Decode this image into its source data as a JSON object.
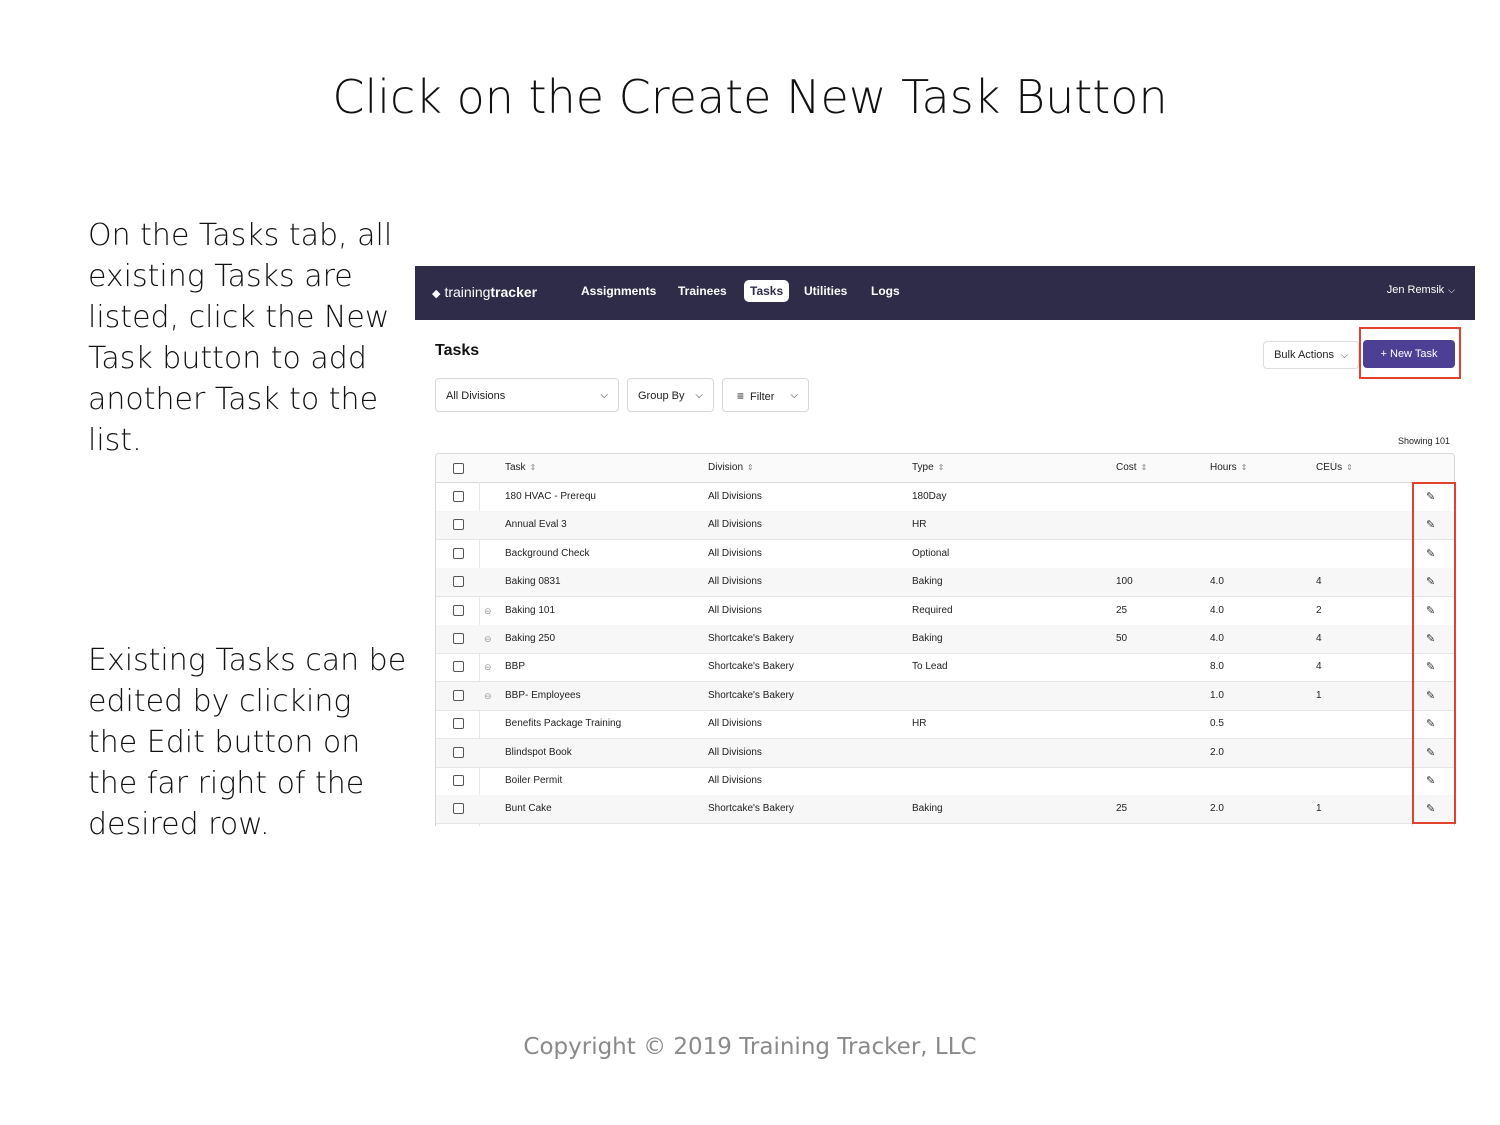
{
  "slide": {
    "title": "Click on the Create New Task Button",
    "instruction_1": "On the Tasks tab, all existing Tasks are listed, click the New Task button to add another Task to the list.",
    "instruction_2": "Existing Tasks can be edited by clicking the Edit button on the far right of the desired row.",
    "copyright": "Copyright © 2019 Training Tracker, LLC",
    "highlight_color": "#e0422e"
  },
  "app": {
    "logo_light": "training",
    "logo_bold": "tracker",
    "nav": [
      {
        "label": "Assignments"
      },
      {
        "label": "Trainees"
      },
      {
        "label": "Tasks",
        "active": true
      },
      {
        "label": "Utilities"
      },
      {
        "label": "Logs"
      }
    ],
    "user": "Jen Remsik",
    "page_title": "Tasks",
    "bulk_actions": "Bulk Actions",
    "new_task": "+ New Task",
    "filters": {
      "division": "All Divisions",
      "group_by": "Group By",
      "filter": "Filter"
    },
    "showing": "Showing 101",
    "colors": {
      "navbar": "#2f2c4a",
      "accent": "#4d3f94"
    }
  },
  "table": {
    "columns": [
      "Task",
      "Division",
      "Type",
      "Cost",
      "Hours",
      "CEUs"
    ],
    "rows": [
      {
        "task": "180 HVAC - Prerequ",
        "division": "All Divisions",
        "type": "180Day",
        "cost": "",
        "hours": "",
        "ceus": "",
        "linked": false
      },
      {
        "task": "Annual Eval 3",
        "division": "All Divisions",
        "type": "HR",
        "cost": "",
        "hours": "",
        "ceus": "",
        "linked": false
      },
      {
        "task": "Background Check",
        "division": "All Divisions",
        "type": "Optional",
        "cost": "",
        "hours": "",
        "ceus": "",
        "linked": false
      },
      {
        "task": "Baking 0831",
        "division": "All Divisions",
        "type": "Baking",
        "cost": "100",
        "hours": "4.0",
        "ceus": "4",
        "linked": false
      },
      {
        "task": "Baking 101",
        "division": "All Divisions",
        "type": "Required",
        "cost": "25",
        "hours": "4.0",
        "ceus": "2",
        "linked": true
      },
      {
        "task": "Baking 250",
        "division": "Shortcake's Bakery",
        "type": "Baking",
        "cost": "50",
        "hours": "4.0",
        "ceus": "4",
        "linked": true
      },
      {
        "task": "BBP",
        "division": "Shortcake's Bakery",
        "type": "To Lead",
        "cost": "",
        "hours": "8.0",
        "ceus": "4",
        "linked": true
      },
      {
        "task": "BBP- Employees",
        "division": "Shortcake's Bakery",
        "type": "",
        "cost": "",
        "hours": "1.0",
        "ceus": "1",
        "linked": true
      },
      {
        "task": "Benefits Package Training",
        "division": "All Divisions",
        "type": "HR",
        "cost": "",
        "hours": "0.5",
        "ceus": "",
        "linked": false
      },
      {
        "task": "Blindspot Book",
        "division": "All Divisions",
        "type": "",
        "cost": "",
        "hours": "2.0",
        "ceus": "",
        "linked": false
      },
      {
        "task": "Boiler Permit",
        "division": "All Divisions",
        "type": "",
        "cost": "",
        "hours": "",
        "ceus": "",
        "linked": false
      },
      {
        "task": "Bunt Cake",
        "division": "Shortcake's Bakery",
        "type": "Baking",
        "cost": "25",
        "hours": "2.0",
        "ceus": "1",
        "linked": false
      }
    ]
  }
}
